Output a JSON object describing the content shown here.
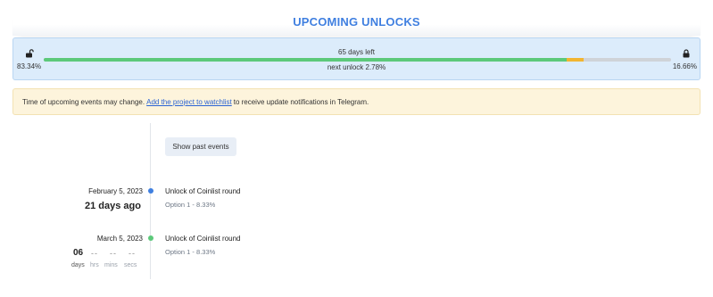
{
  "header": {
    "title": "UPCOMING UNLOCKS"
  },
  "progress": {
    "unlocked_pct_label": "83.34%",
    "locked_pct_label": "16.66%",
    "days_left": "65 days left",
    "next_unlock": "next unlock 2.78%",
    "unlocked_fraction": 0.8334,
    "next_fraction": 0.0278,
    "colors": {
      "unlocked": "#5cc97a",
      "next": "#f2b531",
      "remaining": "#cfd3d8"
    }
  },
  "notice": {
    "before": "Time of upcoming events may change.",
    "link": "Add the project to watchlist",
    "after": "to receive update notifications in Telegram."
  },
  "timeline": {
    "show_past_label": "Show past events",
    "events": [
      {
        "date": "February 5, 2023",
        "relative": "21 days ago",
        "title": "Unlock of Coinlist round",
        "subtitle": "Option 1 - 8.33%",
        "dot_color": "#3f7fe0"
      },
      {
        "date": "March 5, 2023",
        "title": "Unlock of Coinlist round",
        "subtitle": "Option 1 - 8.33%",
        "dot_color": "#5cc97a",
        "countdown": {
          "days": "06",
          "hrs": "--",
          "mins": "--",
          "secs": "--",
          "days_label": "days",
          "hrs_label": "hrs",
          "mins_label": "mins",
          "secs_label": "secs"
        }
      }
    ]
  }
}
